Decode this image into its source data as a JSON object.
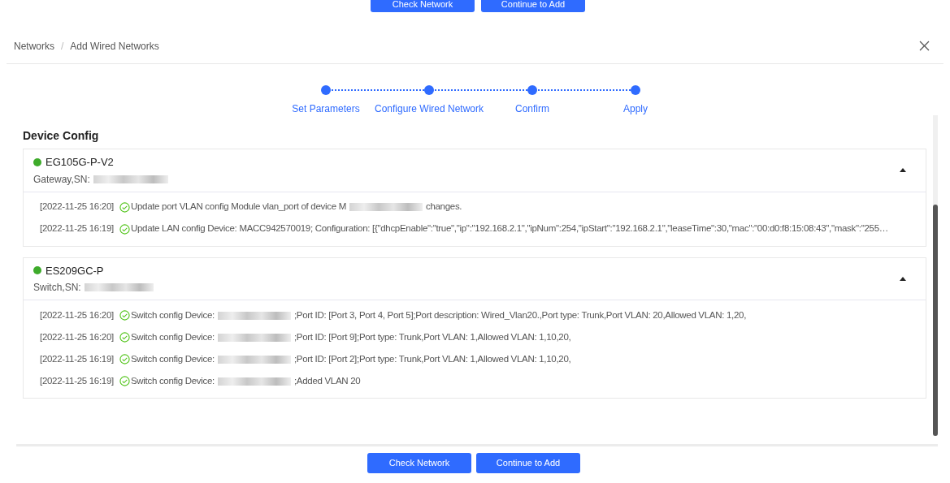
{
  "top_buttons": [
    "Check Network",
    "Continue to Add"
  ],
  "breadcrumb": [
    "Networks",
    "Add Wired Networks"
  ],
  "breadcrumb_separator": "/",
  "steps": [
    "Set Parameters",
    "Configure Wired Network",
    "Confirm",
    "Apply"
  ],
  "section_title": "Device Config",
  "devices": [
    {
      "name": "EG105G-P-V2",
      "online": true,
      "expanded": true,
      "sn_label": "Gateway,SN:",
      "logs": [
        {
          "time": "[2022-11-25 16:20]",
          "before": "Update port VLAN config Module vlan_port of device M",
          "redacted": true,
          "after": "changes."
        },
        {
          "time": "[2022-11-25 16:19]",
          "before": "Update LAN config Device: MACC942570019; Configuration: [{\"dhcpEnable\":\"true\",\"ip\":\"192.168.2.1\",\"ipNum\":254,\"ipStart\":\"192.168.2.1\",\"leaseTime\":30,\"mac\":\"00:d0:f8:15:08:43\",\"mask\":\"255…",
          "redacted": false
        }
      ]
    },
    {
      "name": "ES209GC-P",
      "online": true,
      "expanded": true,
      "sn_label": "Switch,SN:",
      "logs": [
        {
          "time": "[2022-11-25 16:20]",
          "before": "Switch config Device:",
          "redacted": true,
          "after": ";Port ID: [Port 3, Port 4, Port 5];Port description: Wired_Vlan20.,Port type: Trunk,Port VLAN: 20,Allowed VLAN: 1,20,"
        },
        {
          "time": "[2022-11-25 16:20]",
          "before": "Switch config Device:",
          "redacted": true,
          "after": ";Port ID: [Port 9];Port type: Trunk,Port VLAN: 1,Allowed VLAN: 1,10,20,"
        },
        {
          "time": "[2022-11-25 16:19]",
          "before": "Switch config Device:",
          "redacted": true,
          "after": ";Port ID: [Port 2];Port type: Trunk,Port VLAN: 1,Allowed VLAN: 1,10,20,"
        },
        {
          "time": "[2022-11-25 16:19]",
          "before": "Switch config Device:",
          "redacted": true,
          "after": ";Added VLAN 20"
        }
      ]
    }
  ],
  "bottom_buttons": [
    "Check Network",
    "Continue to Add"
  ]
}
